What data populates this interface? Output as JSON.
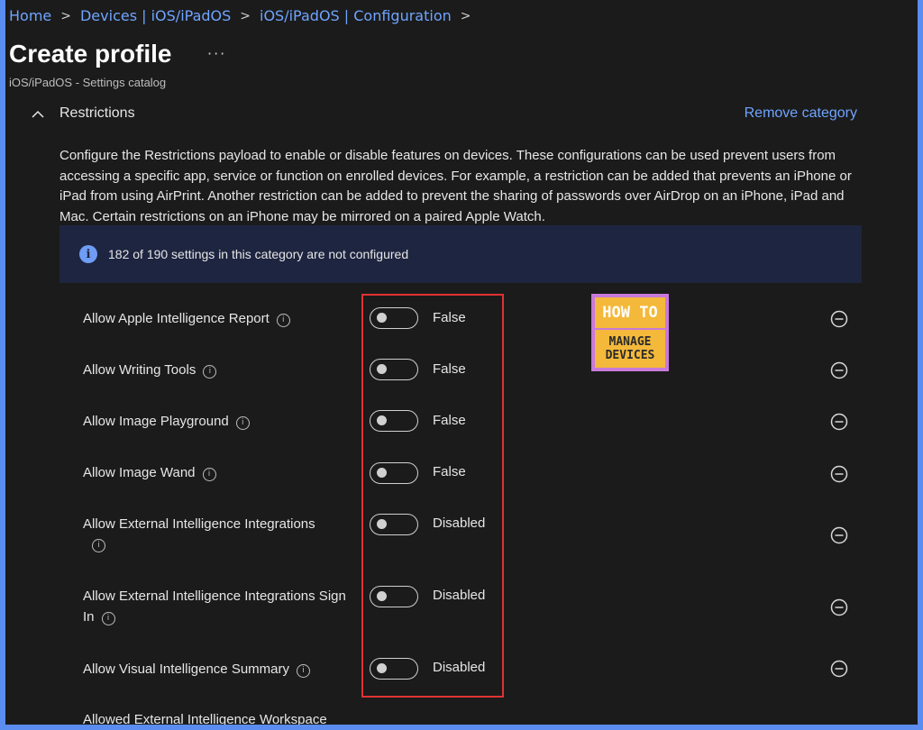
{
  "breadcrumb": {
    "items": [
      "Home",
      "Devices | iOS/iPadOS",
      "iOS/iPadOS | Configuration"
    ]
  },
  "header": {
    "title": "Create profile",
    "more_label": "···",
    "subtitle": "iOS/iPadOS - Settings catalog"
  },
  "category": {
    "name": "Restrictions",
    "remove_label": "Remove category",
    "description": "Configure the Restrictions payload to enable or disable features on devices. These configurations can be used prevent users from accessing a specific app, service or function on enrolled devices. For example, a restriction can be added that prevents an iPhone or iPad from using AirPrint. Another restriction can be added to prevent the sharing of passwords over AirDrop on an iPhone, iPad and Mac. Certain restrictions on an iPhone may be mirrored on a paired Apple Watch.",
    "info_banner": "182 of 190 settings in this category are not configured"
  },
  "settings": [
    {
      "label": "Allow Apple Intelligence Report",
      "value": "False"
    },
    {
      "label": "Allow Writing Tools",
      "value": "False"
    },
    {
      "label": "Allow Image Playground",
      "value": "False"
    },
    {
      "label": "Allow Image Wand",
      "value": "False"
    },
    {
      "label": "Allow External Intelligence Integrations",
      "value": "Disabled"
    },
    {
      "label": "Allow External Intelligence Integrations Sign In",
      "value": "Disabled"
    },
    {
      "label": "Allow Visual Intelligence Summary",
      "value": "Disabled"
    }
  ],
  "partial_setting_label": "Allowed External Intelligence Workspace",
  "logo": {
    "line1": "HOW TO",
    "line2": "MANAGE",
    "line3": "DEVICES"
  },
  "colors": {
    "accent": "#6fa4ff",
    "highlight": "#e03232",
    "banner_bg": "#1e2540"
  },
  "icons": {
    "chevron": "chevron-up-icon",
    "info": "info-icon",
    "remove": "minus-circle-icon"
  }
}
